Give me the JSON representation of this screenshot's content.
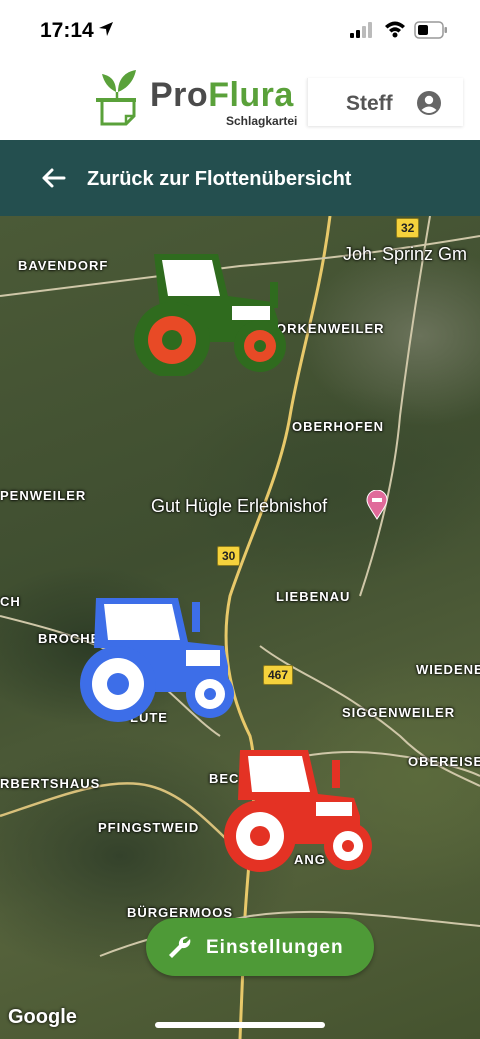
{
  "status_bar": {
    "time": "17:14"
  },
  "header": {
    "brand_part1": "Pro",
    "brand_part2": "Flura",
    "tagline": "Schlagkartei",
    "user_name": "Steff"
  },
  "nav": {
    "back_label": "Zurück zur Flottenübersicht"
  },
  "map": {
    "places": [
      "BAVENDORF",
      "ORKENWEILER",
      "OBERHOFEN",
      "PENWEILER",
      "LIEBENAU",
      "BROCHE",
      "WIEDENE",
      "SIGGENWEILER",
      "OBEREISE",
      "RBERTSHAUS",
      "BEC",
      "PFINGSTWEID",
      "BÜRGERMOOS",
      "CH",
      "LUTE",
      "ANG"
    ],
    "pois": [
      "Joh. Sprinz Gm",
      "Gut Hügle Erlebnishof"
    ],
    "road_shields": [
      "32",
      "30",
      "467",
      "467"
    ],
    "attribution": "Google"
  },
  "vehicles": [
    {
      "name": "tractor-green",
      "color": "#2f6b1e",
      "accent": "#e84a26"
    },
    {
      "name": "tractor-blue",
      "color": "#3d6ee8",
      "accent": "#ffffff"
    },
    {
      "name": "tractor-red",
      "color": "#e43224",
      "accent": "#ffffff"
    }
  ],
  "actions": {
    "settings_label": "Einstellungen"
  }
}
